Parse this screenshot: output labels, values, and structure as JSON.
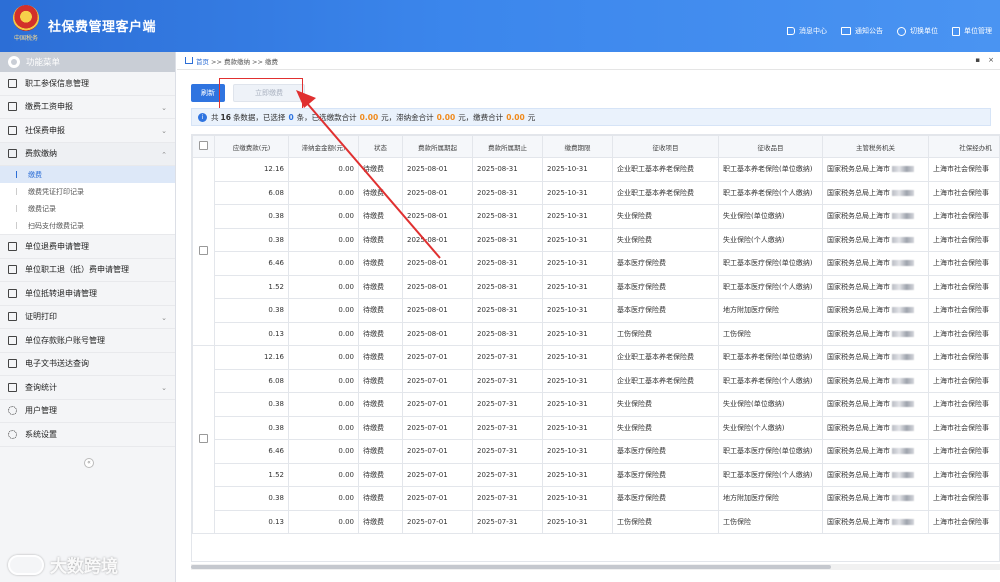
{
  "app": {
    "title": "社保费管理客户端",
    "logo_text": "中国税务"
  },
  "header_menu": [
    {
      "label": "消息中心",
      "icon": "speaker-icon"
    },
    {
      "label": "通知公告",
      "icon": "mail-icon"
    },
    {
      "label": "切换单位",
      "icon": "switch-icon"
    },
    {
      "label": "单位管理",
      "icon": "building-icon"
    }
  ],
  "sidebar": {
    "title": "功能菜单",
    "items": [
      {
        "label": "职工参保信息管理",
        "arrow": ""
      },
      {
        "label": "缴费工资申报",
        "arrow": "⌄"
      },
      {
        "label": "社保费申报",
        "arrow": "⌄"
      },
      {
        "label": "费款缴纳",
        "arrow": "⌃"
      },
      {
        "label": "单位退费申请管理",
        "arrow": ""
      },
      {
        "label": "单位职工退（抵）费申请管理",
        "arrow": ""
      },
      {
        "label": "单位抵转退申请管理",
        "arrow": ""
      },
      {
        "label": "证明打印",
        "arrow": "⌄"
      },
      {
        "label": "单位存款账户账号管理",
        "arrow": ""
      },
      {
        "label": "电子文书送达查询",
        "arrow": ""
      },
      {
        "label": "查询统计",
        "arrow": "⌄"
      },
      {
        "label": "用户管理",
        "arrow": ""
      },
      {
        "label": "系统设置",
        "arrow": ""
      }
    ],
    "submenu": [
      "缴费",
      "缴费凭证打印记录",
      "缴费记录",
      "扫码支付缴费记录"
    ],
    "collapse": "«"
  },
  "breadcrumb": {
    "home": "首页",
    "path": " >> 费款缴纳 >> 缴费"
  },
  "window_controls": {
    "pin": "▪",
    "close": "×"
  },
  "toolbar": {
    "refresh": "刷新",
    "pay_now": "立即缴费"
  },
  "summary": {
    "prefix": "共",
    "total": "16",
    "mid1": "条数据，已选择",
    "selected": "0",
    "mid2": "条，已选缴款合计",
    "amount": "0.00",
    "mid3": "元，滞纳金合计",
    "late_fee": "0.00",
    "mid4": "元，缴费合计",
    "pay_total": "0.00",
    "suffix": "元"
  },
  "table": {
    "headers": [
      "应缴费款(元)",
      "滞纳金金额(元)",
      "状态",
      "费款所属期起",
      "费款所属期止",
      "缴费期限",
      "征收项目",
      "征收品目",
      "主管税务机关",
      "社保经办机"
    ],
    "rows": [
      [
        "12.16",
        "0.00",
        "待缴费",
        "2025-08-01",
        "2025-08-31",
        "2025-10-31",
        "企业职工基本养老保险费",
        "职工基本养老保险(单位缴纳)",
        "国家税务总局上海市",
        "上海市社会保险事"
      ],
      [
        "6.08",
        "0.00",
        "待缴费",
        "2025-08-01",
        "2025-08-31",
        "2025-10-31",
        "企业职工基本养老保险费",
        "职工基本养老保险(个人缴纳)",
        "国家税务总局上海市",
        "上海市社会保险事"
      ],
      [
        "0.38",
        "0.00",
        "待缴费",
        "2025-08-01",
        "2025-08-31",
        "2025-10-31",
        "失业保险费",
        "失业保险(单位缴纳)",
        "国家税务总局上海市",
        "上海市社会保险事"
      ],
      [
        "0.38",
        "0.00",
        "待缴费",
        "2025-08-01",
        "2025-08-31",
        "2025-10-31",
        "失业保险费",
        "失业保险(个人缴纳)",
        "国家税务总局上海市",
        "上海市社会保险事"
      ],
      [
        "6.46",
        "0.00",
        "待缴费",
        "2025-08-01",
        "2025-08-31",
        "2025-10-31",
        "基本医疗保险费",
        "职工基本医疗保险(单位缴纳)",
        "国家税务总局上海市",
        "上海市社会保险事"
      ],
      [
        "1.52",
        "0.00",
        "待缴费",
        "2025-08-01",
        "2025-08-31",
        "2025-10-31",
        "基本医疗保险费",
        "职工基本医疗保险(个人缴纳)",
        "国家税务总局上海市",
        "上海市社会保险事"
      ],
      [
        "0.38",
        "0.00",
        "待缴费",
        "2025-08-01",
        "2025-08-31",
        "2025-10-31",
        "基本医疗保险费",
        "地方附加医疗保险",
        "国家税务总局上海市",
        "上海市社会保险事"
      ],
      [
        "0.13",
        "0.00",
        "待缴费",
        "2025-08-01",
        "2025-08-31",
        "2025-10-31",
        "工伤保险费",
        "工伤保险",
        "国家税务总局上海市",
        "上海市社会保险事"
      ],
      [
        "12.16",
        "0.00",
        "待缴费",
        "2025-07-01",
        "2025-07-31",
        "2025-10-31",
        "企业职工基本养老保险费",
        "职工基本养老保险(单位缴纳)",
        "国家税务总局上海市",
        "上海市社会保险事"
      ],
      [
        "6.08",
        "0.00",
        "待缴费",
        "2025-07-01",
        "2025-07-31",
        "2025-10-31",
        "企业职工基本养老保险费",
        "职工基本养老保险(个人缴纳)",
        "国家税务总局上海市",
        "上海市社会保险事"
      ],
      [
        "0.38",
        "0.00",
        "待缴费",
        "2025-07-01",
        "2025-07-31",
        "2025-10-31",
        "失业保险费",
        "失业保险(单位缴纳)",
        "国家税务总局上海市",
        "上海市社会保险事"
      ],
      [
        "0.38",
        "0.00",
        "待缴费",
        "2025-07-01",
        "2025-07-31",
        "2025-10-31",
        "失业保险费",
        "失业保险(个人缴纳)",
        "国家税务总局上海市",
        "上海市社会保险事"
      ],
      [
        "6.46",
        "0.00",
        "待缴费",
        "2025-07-01",
        "2025-07-31",
        "2025-10-31",
        "基本医疗保险费",
        "职工基本医疗保险(单位缴纳)",
        "国家税务总局上海市",
        "上海市社会保险事"
      ],
      [
        "1.52",
        "0.00",
        "待缴费",
        "2025-07-01",
        "2025-07-31",
        "2025-10-31",
        "基本医疗保险费",
        "职工基本医疗保险(个人缴纳)",
        "国家税务总局上海市",
        "上海市社会保险事"
      ],
      [
        "0.38",
        "0.00",
        "待缴费",
        "2025-07-01",
        "2025-07-31",
        "2025-10-31",
        "基本医疗保险费",
        "地方附加医疗保险",
        "国家税务总局上海市",
        "上海市社会保险事"
      ],
      [
        "0.13",
        "0.00",
        "待缴费",
        "2025-07-01",
        "2025-07-31",
        "2025-10-31",
        "工伤保险费",
        "工伤保险",
        "国家税务总局上海市",
        "上海市社会保险事"
      ]
    ]
  },
  "annotation": {
    "color": "#e03030"
  },
  "watermark": "大数跨境"
}
